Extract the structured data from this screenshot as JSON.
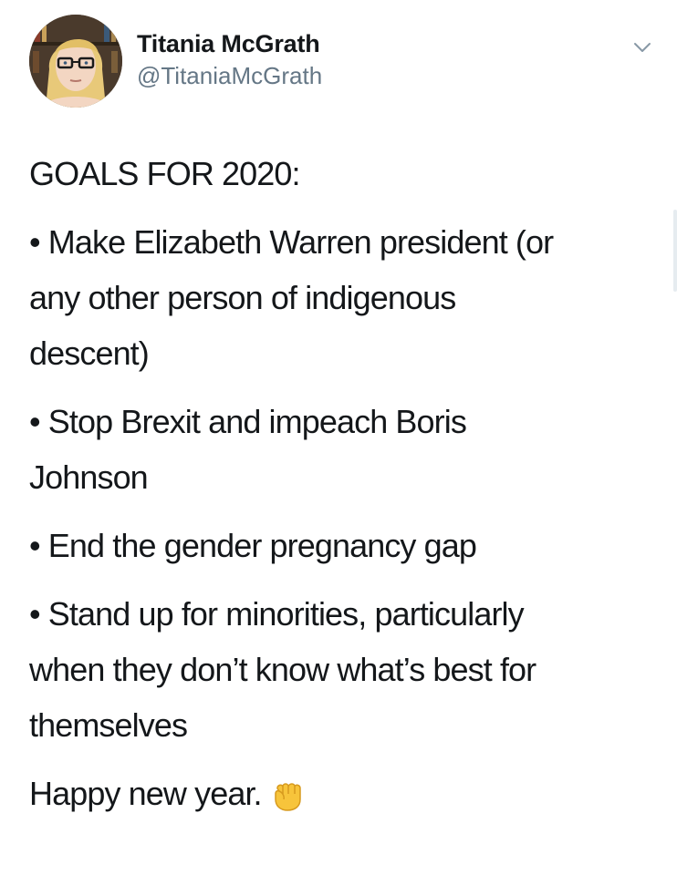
{
  "user": {
    "display_name": "Titania McGrath",
    "handle": "@TitaniaMcGrath",
    "avatar_icon": "avatar-photo"
  },
  "menu": {
    "icon": "chevron-down-icon"
  },
  "tweet": {
    "heading": "GOALS FOR 2020:",
    "bullets": [
      {
        "lines": [
          "• Make Elizabeth Warren president (or",
          "any other person of indigenous",
          "descent)"
        ]
      },
      {
        "lines": [
          "• Stop Brexit and impeach Boris",
          "Johnson"
        ]
      },
      {
        "lines": [
          "• End the gender pregnancy gap"
        ]
      },
      {
        "lines": [
          "• Stand up for minorities, particularly",
          "when they don’t know what’s best for",
          "themselves"
        ]
      }
    ],
    "closing": "Happy new year.",
    "closing_emoji": "raised-fist-icon"
  },
  "colors": {
    "text": "#14171a",
    "secondary": "#657786",
    "emoji_fill": "#f7c43b"
  }
}
